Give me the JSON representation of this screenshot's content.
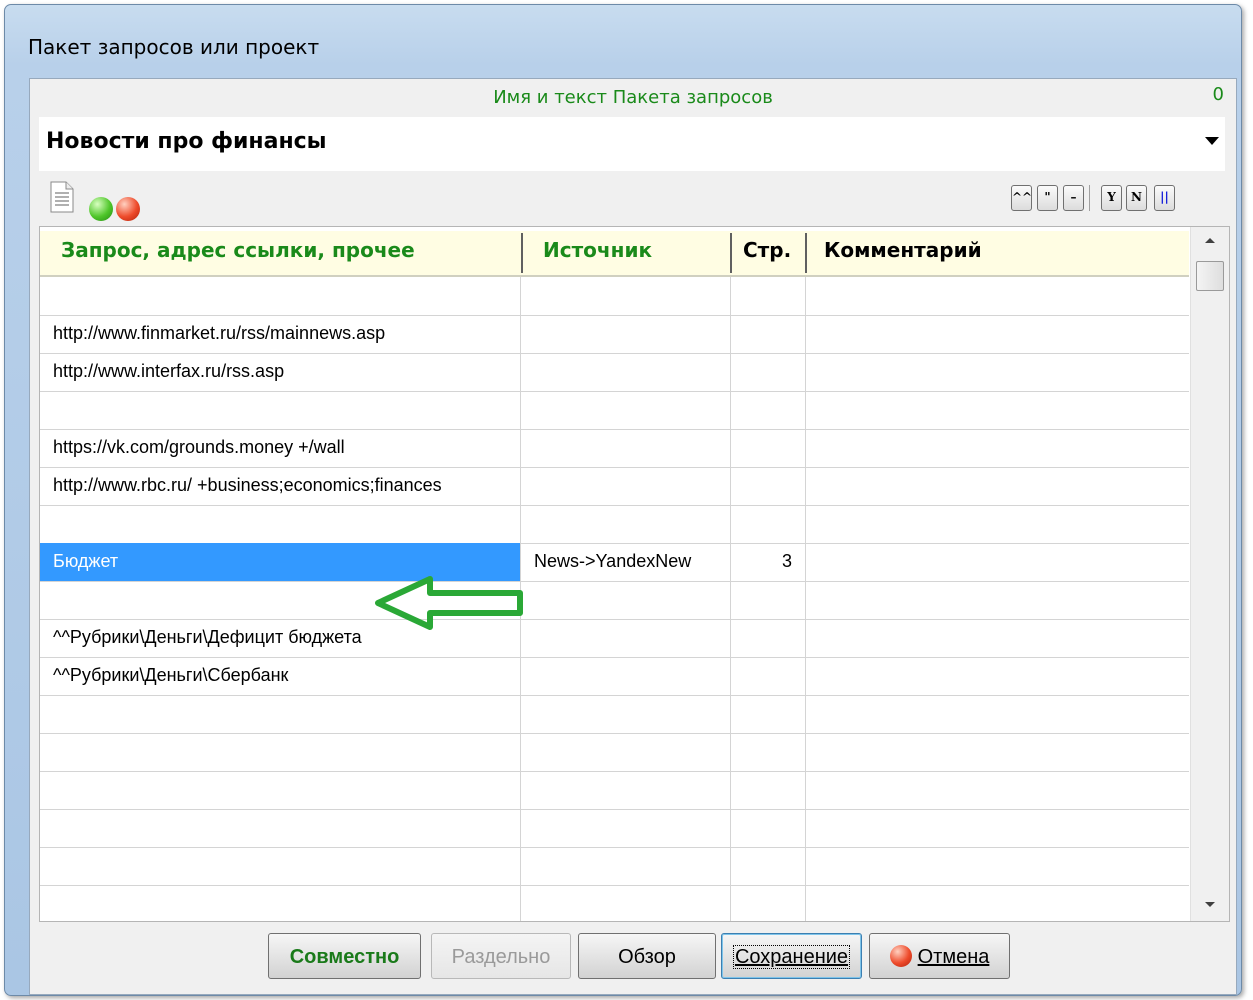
{
  "window": {
    "title": "Пакет запросов или проект"
  },
  "panel": {
    "caption": "Имя и текст Пакета запросов",
    "counter": "0"
  },
  "combo": {
    "value": "Новости про финансы"
  },
  "toolbar": {
    "icons": [
      "document-icon",
      "green-circle-icon",
      "red-circle-icon"
    ],
    "buttons": [
      {
        "name": "double-caret-button",
        "label": "^^"
      },
      {
        "name": "quote-button",
        "label": "\""
      },
      {
        "name": "minus-button",
        "label": "–"
      },
      {
        "name": "y-button",
        "label": "Y"
      },
      {
        "name": "n-button",
        "label": "N"
      },
      {
        "name": "pause-bar-button",
        "label": "||"
      }
    ]
  },
  "grid": {
    "columns": [
      "Запрос, адрес ссылки, прочее",
      "Источник",
      "Стр.",
      "Комментарий"
    ],
    "rows": [
      [
        "",
        "",
        "",
        ""
      ],
      [
        "http://www.finmarket.ru/rss/mainnews.asp",
        "",
        "",
        ""
      ],
      [
        "http://www.interfax.ru/rss.asp",
        "",
        "",
        ""
      ],
      [
        "",
        "",
        "",
        ""
      ],
      [
        "https://vk.com/grounds.money +/wall",
        "",
        "",
        ""
      ],
      [
        "http://www.rbc.ru/ +business;economics;finances",
        "",
        "",
        ""
      ],
      [
        "",
        "",
        "",
        ""
      ],
      [
        "Бюджет",
        "News->YandexNew",
        "3",
        ""
      ],
      [
        "",
        "",
        "",
        ""
      ],
      [
        "^^Рубрики\\Деньги\\Дефицит бюджета",
        "",
        "",
        ""
      ],
      [
        "^^Рубрики\\Деньги\\Сбербанк",
        "",
        "",
        ""
      ],
      [
        "",
        "",
        "",
        ""
      ],
      [
        "",
        "",
        "",
        ""
      ],
      [
        "",
        "",
        "",
        ""
      ],
      [
        "",
        "",
        "",
        ""
      ],
      [
        "",
        "",
        "",
        ""
      ],
      [
        "",
        "",
        "",
        ""
      ]
    ],
    "selected_row": 7
  },
  "annotation": {
    "arrow_color": "#2aa836"
  },
  "colors": {
    "green_text": "#1a8a1a",
    "selection": "#3399ff",
    "header_bg": "#fffde3"
  },
  "footer": {
    "buttons": [
      {
        "label": "Совместно",
        "enabled": true
      },
      {
        "label": "Раздельно",
        "enabled": false
      },
      {
        "label": "Обзор",
        "enabled": true
      },
      {
        "label": "Сохранение",
        "enabled": true
      },
      {
        "label": "Отмена",
        "enabled": true
      }
    ]
  }
}
